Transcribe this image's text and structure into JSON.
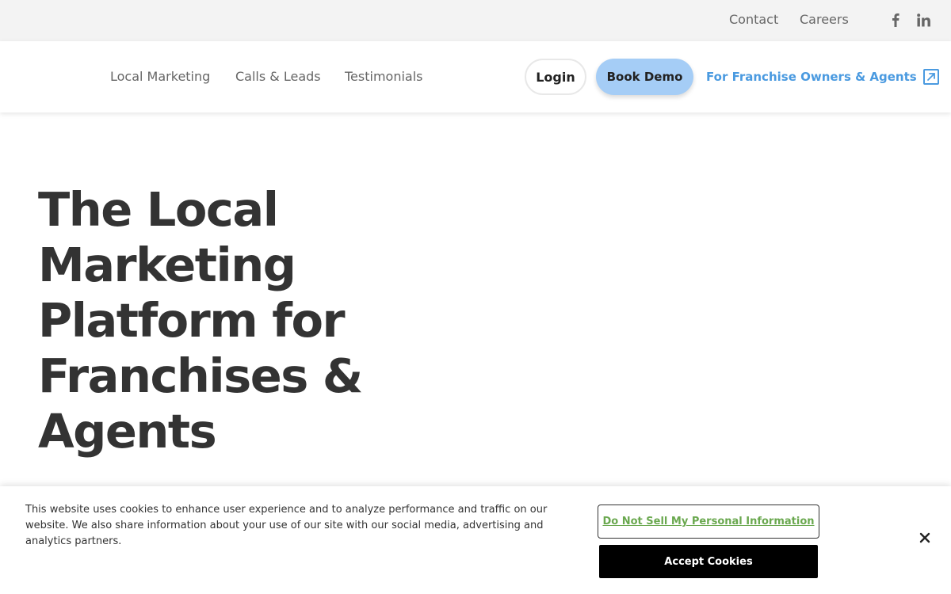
{
  "topbar": {
    "contact": "Contact",
    "careers": "Careers",
    "social": [
      "facebook-icon",
      "linkedin-icon"
    ]
  },
  "nav": {
    "items": [
      {
        "label": "Local Marketing"
      },
      {
        "label": "Calls & Leads"
      },
      {
        "label": "Testimonials"
      }
    ],
    "login": "Login",
    "book_demo": "Book Demo",
    "franchise_link": "For Franchise Owners & Agents"
  },
  "hero": {
    "title": "The Local Marketing Platform for Franchises & Agents"
  },
  "cookie": {
    "text": "This website uses cookies to enhance user experience and to analyze performance and traffic on our website. We also share information about your use of our site with our social media, advertising and analytics partners.",
    "do_not_sell": "Do Not Sell My Personal Information",
    "accept": "Accept Cookies"
  },
  "colors": {
    "accent_blue": "#4a9ae0",
    "demo_button": "#a5cdf6",
    "dnsmpi_text": "#6aa84f",
    "text_dark": "#333333"
  }
}
